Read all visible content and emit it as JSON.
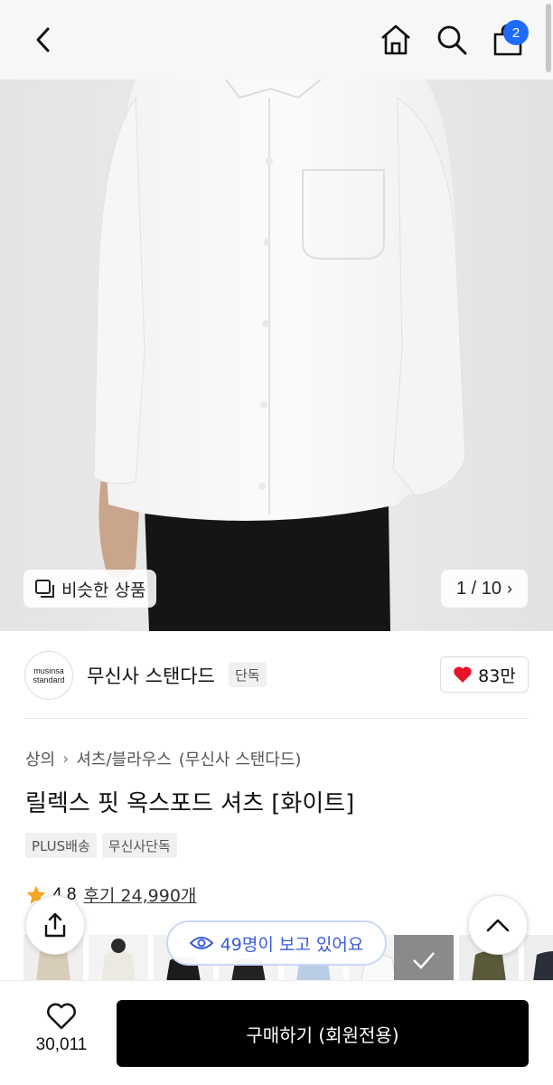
{
  "nav": {
    "back_icon": "chevron-left-icon",
    "home_icon": "home-icon",
    "search_icon": "search-icon",
    "cart_icon": "shopping-bag-icon",
    "cart_count": "2",
    "badge_color": "#1f6bff"
  },
  "gallery": {
    "similar_label": "비슷한 상품",
    "pager": "1 / 10"
  },
  "brand": {
    "logo_line1": "musinsa",
    "logo_line2": "standard",
    "name": "무신사 스탠다드",
    "tag": "단독",
    "likes": "83만",
    "like_color": "#e8142a"
  },
  "product": {
    "breadcrumb": [
      "상의",
      "셔츠/블라우스"
    ],
    "breadcrumb_extra": "(무신사 스탠다드)",
    "title": "릴렉스 핏 옥스포드 셔츠 [화이트]",
    "tags": [
      "PLUS배송",
      "무신사단독"
    ],
    "rating": "4.8",
    "reviews": "후기 24,990개",
    "star_color": "#f5a623"
  },
  "viewers": {
    "label": "49명이 보고 있어요",
    "color": "#3a5bd6"
  },
  "bottom": {
    "wish_count": "30,011",
    "buy_label": "구매하기 (회원전용)"
  }
}
